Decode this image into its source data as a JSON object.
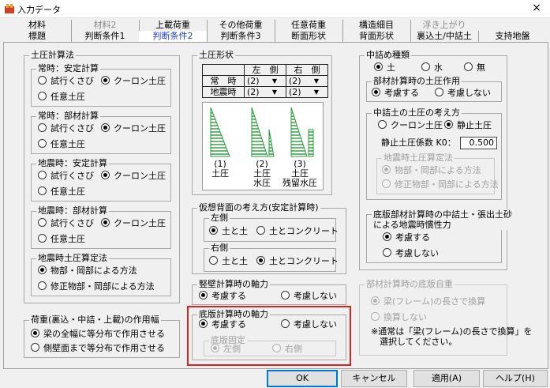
{
  "window": {
    "title": "入力データ",
    "close": "×"
  },
  "tabs_row1": [
    "材料",
    "材料2",
    "上載荷重",
    "その他荷重",
    "任意荷重",
    "構造細目",
    "浮き上がり"
  ],
  "tabs_row2": [
    "標題",
    "判断条件1",
    "判断条件2",
    "判断条件3",
    "断面形状",
    "背面形状",
    "裏込土/中詰土",
    "支持地盤"
  ],
  "earth_method": {
    "title": "土圧計算法",
    "normal_stability": {
      "title": "常時：安定計算",
      "opt1": "試行くさび",
      "opt2": "クーロン土圧",
      "opt3": "任意土圧"
    },
    "normal_member": {
      "title": "常時：部材計算",
      "opt1": "試行くさび",
      "opt2": "クーロン土圧",
      "opt3": "任意土圧"
    },
    "quake_stability": {
      "title": "地震時：安定計算",
      "opt1": "試行くさび",
      "opt2": "クーロン土圧",
      "opt3": "任意土圧"
    },
    "quake_member": {
      "title": "地震時：部材計算",
      "opt1": "試行くさび",
      "opt2": "クーロン土圧",
      "opt3": "任意土圧"
    },
    "quake_method": {
      "title": "地震時土圧算定法",
      "opt1": "物部・岡部による方法",
      "opt2": "修正物部・岡部による方法"
    }
  },
  "load_width": {
    "title": "荷重(裏込・中詰・上載)の作用幅",
    "opt1": "梁の全幅に等分布で作用させる",
    "opt2": "側壁面まで等分布で作用させる"
  },
  "earth_shape": {
    "title": "土圧形状",
    "col_left": "左　側",
    "col_right": "右　側",
    "row1": "常　時",
    "row2": "地震時",
    "r1_left": "(2)",
    "r1_right": "(2)",
    "r2_left": "(2)",
    "r2_right": "(2)",
    "dropdown_arrow": "▼",
    "cap1": "(1)\n土圧",
    "cap2": "(2)\n土圧\n水圧",
    "cap3": "(3)\n土圧\n残留水圧"
  },
  "virtual_back": {
    "title": "仮想背面の考え方(安定計算時)",
    "left": {
      "title": "左側",
      "opt1": "土と土",
      "opt2": "土とコンクリート"
    },
    "right": {
      "title": "右側",
      "opt1": "土と土",
      "opt2": "土とコンクリート"
    }
  },
  "wall_axial": {
    "title": "竪壁計算時の軸力",
    "opt1": "考慮する",
    "opt2": "考慮しない"
  },
  "slab_axial": {
    "title": "底版計算時の軸力",
    "opt1": "考慮する",
    "opt2": "考慮しない",
    "fixed": {
      "title": "底版固定",
      "opt1": "左側",
      "opt2": "右側"
    }
  },
  "fill_type": {
    "title": "中詰め種類",
    "opt1": "土",
    "opt2": "水",
    "opt3": "無"
  },
  "member_earth_action": {
    "title": "部材計算時の土圧作用",
    "opt1": "考慮する",
    "opt2": "考慮しない"
  },
  "fill_earth_concept": {
    "title": "中詰土の土圧の考え方",
    "opt1": "クーロン土圧",
    "opt2": "静止土圧",
    "k0_label": "静止土圧係数 K0：",
    "k0_value": "0.500",
    "calc": {
      "title": "地震時土圧算定法",
      "opt1": "物部・岡部による方法",
      "opt2": "修正物部・岡部による方法"
    }
  },
  "slab_inertia": {
    "title": "底版部材計算時の中詰土・張出土砂\nによる地震時慣性力",
    "opt1": "考慮する",
    "opt2": "考慮しない"
  },
  "member_self_weight": {
    "title": "部材計算時の底版自重",
    "opt1": "梁(フレーム)の長さで換算",
    "opt2": "換算しない",
    "note": "※通常は「梁(フレーム)の長さで換算」を\n　選択してください。"
  },
  "buttons": {
    "ok": "OK",
    "cancel": "キャンセル",
    "apply": "適用(A)",
    "help": "ヘルプ(H)"
  },
  "colors": {
    "accent": "#1a3fd0",
    "highlight": "#e02020",
    "hatch": "#2a9a3a"
  }
}
